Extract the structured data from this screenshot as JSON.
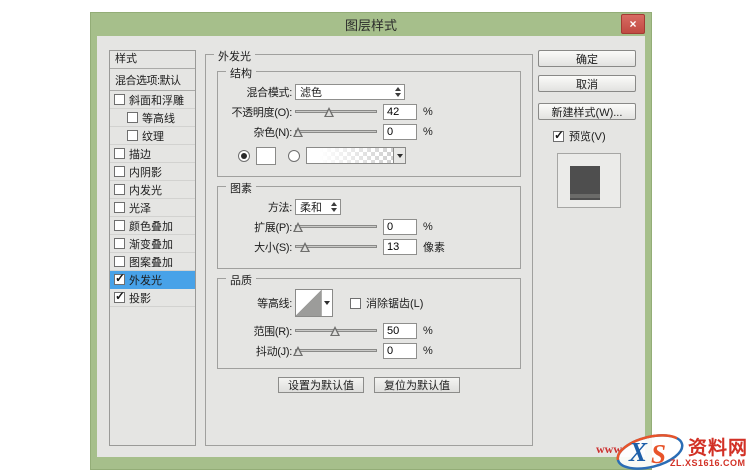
{
  "colors": {
    "titlebar_green": "#a6bf8b",
    "close_red": "#c9534c",
    "selection_blue": "#48a2e8",
    "dialog_body_gray": "#e5e5e3",
    "watermark_red": "#d23126"
  },
  "window": {
    "title": "图层样式",
    "close": "×"
  },
  "sidebar": {
    "header": "样式",
    "blend_options": "混合选项:默认",
    "items": [
      {
        "label": "斜面和浮雕",
        "checked": false,
        "selected": false
      },
      {
        "label": "等高线",
        "checked": false,
        "selected": false
      },
      {
        "label": "纹理",
        "checked": false,
        "selected": false
      },
      {
        "label": "描边",
        "checked": false,
        "selected": false
      },
      {
        "label": "内阴影",
        "checked": false,
        "selected": false
      },
      {
        "label": "内发光",
        "checked": false,
        "selected": false
      },
      {
        "label": "光泽",
        "checked": false,
        "selected": false
      },
      {
        "label": "颜色叠加",
        "checked": false,
        "selected": false
      },
      {
        "label": "渐变叠加",
        "checked": false,
        "selected": false
      },
      {
        "label": "图案叠加",
        "checked": false,
        "selected": false
      },
      {
        "label": "外发光",
        "checked": true,
        "selected": true
      },
      {
        "label": "投影",
        "checked": true,
        "selected": false
      }
    ]
  },
  "panel": {
    "title": "外发光",
    "structure": {
      "legend": "结构",
      "blend_mode_label": "混合模式:",
      "blend_mode_value": "滤色",
      "opacity_label": "不透明度(O):",
      "opacity_value": "42",
      "opacity_unit": "%",
      "opacity_pos": "41%",
      "noise_label": "杂色(N):",
      "noise_value": "0",
      "noise_unit": "%",
      "noise_pos": "4%"
    },
    "elements": {
      "legend": "图素",
      "technique_label": "方法:",
      "technique_value": "柔和",
      "spread_label": "扩展(P):",
      "spread_value": "0",
      "spread_unit": "%",
      "spread_pos": "4%",
      "size_label": "大小(S):",
      "size_value": "13",
      "size_unit": "像素",
      "size_pos": "12%"
    },
    "quality": {
      "legend": "品质",
      "contour_label": "等高线:",
      "antialias_label": "消除锯齿(L)",
      "range_label": "范围(R):",
      "range_value": "50",
      "range_unit": "%",
      "range_pos": "49%",
      "jitter_label": "抖动(J):",
      "jitter_value": "0",
      "jitter_unit": "%",
      "jitter_pos": "4%"
    },
    "buttons": {
      "set_default": "设置为默认值",
      "reset_default": "复位为默认值"
    }
  },
  "actions": {
    "ok": "确定",
    "cancel": "取消",
    "new_style": "新建样式(W)...",
    "preview": "预览(V)"
  },
  "watermark": {
    "prefix": "www",
    "logo_x": "X",
    "logo_s": "S",
    "site_name": "资料网",
    "site_url": "ZL.XS1616.COM"
  }
}
